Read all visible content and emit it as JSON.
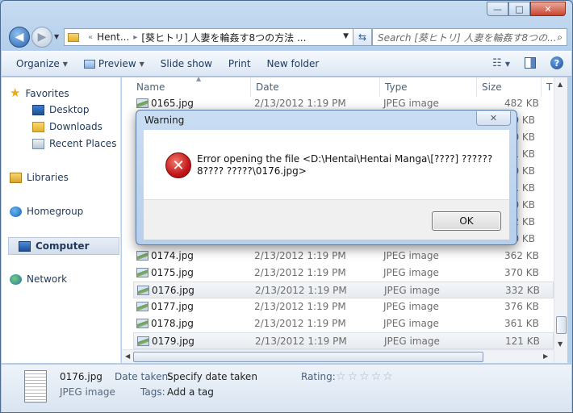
{
  "address": {
    "crumb_parent": "Hent...",
    "crumb_current": "[葵ヒトリ] 人妻を輪姦す8つの方法 ..."
  },
  "search": {
    "placeholder": "Search [葵ヒトリ] 人妻を輪姦す8つの..."
  },
  "toolbar": {
    "organize": "Organize",
    "preview": "Preview",
    "slideshow": "Slide show",
    "print": "Print",
    "new_folder": "New folder"
  },
  "sidebar": {
    "favorites": "Favorites",
    "desktop": "Desktop",
    "downloads": "Downloads",
    "recent_places": "Recent Places",
    "libraries": "Libraries",
    "homegroup": "Homegroup",
    "computer": "Computer",
    "network": "Network"
  },
  "columns": {
    "name": "Name",
    "date": "Date",
    "type": "Type",
    "size": "Size",
    "extra": "T"
  },
  "files": [
    {
      "name": "0165.jpg",
      "date": "2/13/2012 1:19 PM",
      "type": "JPEG image",
      "size": "482 KB"
    },
    {
      "name": "",
      "date": "",
      "type": "",
      "size": "9 KB"
    },
    {
      "name": "",
      "date": "",
      "type": "",
      "size": "0 KB"
    },
    {
      "name": "",
      "date": "",
      "type": "",
      "size": "1 KB"
    },
    {
      "name": "",
      "date": "",
      "type": "",
      "size": "0 KB"
    },
    {
      "name": "",
      "date": "",
      "type": "",
      "size": "1 KB"
    },
    {
      "name": "",
      "date": "",
      "type": "",
      "size": "0 KB"
    },
    {
      "name": "",
      "date": "",
      "type": "",
      "size": "2 KB"
    },
    {
      "name": "",
      "date": "",
      "type": "",
      "size": "0 KB"
    },
    {
      "name": "0174.jpg",
      "date": "2/13/2012 1:19 PM",
      "type": "JPEG image",
      "size": "362 KB"
    },
    {
      "name": "0175.jpg",
      "date": "2/13/2012 1:19 PM",
      "type": "JPEG image",
      "size": "370 KB"
    },
    {
      "name": "0176.jpg",
      "date": "2/13/2012 1:19 PM",
      "type": "JPEG image",
      "size": "332 KB"
    },
    {
      "name": "0177.jpg",
      "date": "2/13/2012 1:19 PM",
      "type": "JPEG image",
      "size": "376 KB"
    },
    {
      "name": "0178.jpg",
      "date": "2/13/2012 1:19 PM",
      "type": "JPEG image",
      "size": "361 KB"
    },
    {
      "name": "0179.jpg",
      "date": "2/13/2012 1:19 PM",
      "type": "JPEG image",
      "size": "121 KB"
    }
  ],
  "details": {
    "filename": "0176.jpg",
    "filetype": "JPEG image",
    "date_taken_label": "Date taken:",
    "date_taken_value": "Specify date taken",
    "tags_label": "Tags:",
    "tags_value": "Add a tag",
    "rating_label": "Rating:"
  },
  "dialog": {
    "title": "Warning",
    "message": "Error opening the file <D:\\Hentai\\Hentai Manga\\[????] ??????8???? ?????\\0176.jpg>",
    "ok_label": "OK"
  }
}
